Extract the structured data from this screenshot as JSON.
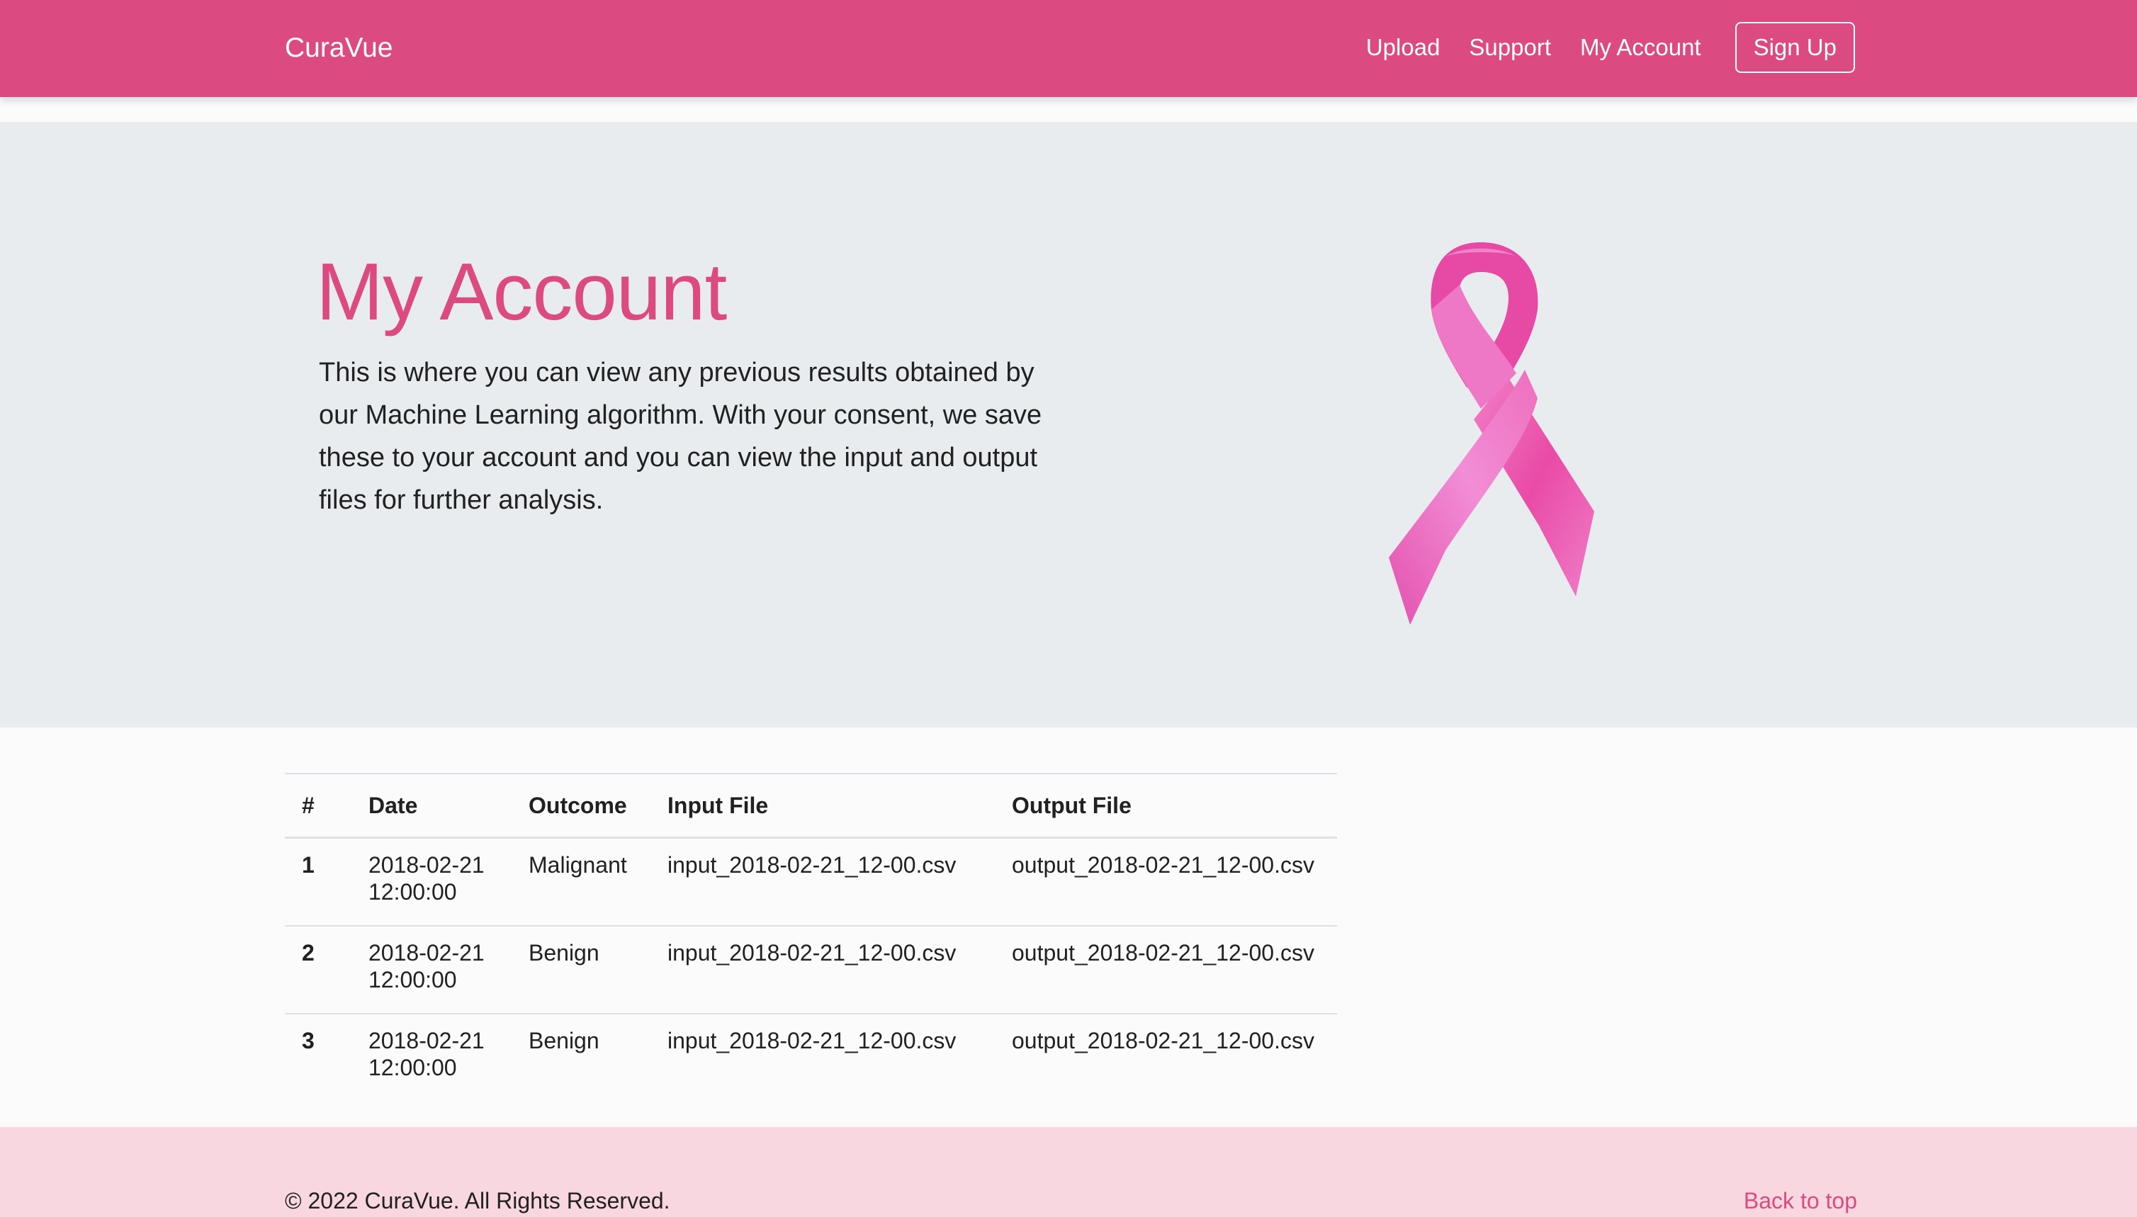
{
  "navbar": {
    "brand": "CuraVue",
    "links": [
      "Upload",
      "Support",
      "My Account"
    ],
    "signup_label": "Sign Up"
  },
  "hero": {
    "title": "My Account",
    "text": "This is where you can view any previous results obtained by our Machine Learning algorithm. With your consent, we save these to your account and you can view the input and output files for further analysis."
  },
  "table": {
    "headers": [
      "#",
      "Date",
      "Outcome",
      "Input File",
      "Output File"
    ],
    "rows": [
      {
        "num": "1",
        "date": "2018-02-21",
        "time": "12:00:00",
        "outcome": "Malignant",
        "input": "input_2018-02-21_12-00.csv",
        "output": "output_2018-02-21_12-00.csv"
      },
      {
        "num": "2",
        "date": "2018-02-21",
        "time": "12:00:00",
        "outcome": "Benign",
        "input": "input_2018-02-21_12-00.csv",
        "output": "output_2018-02-21_12-00.csv"
      },
      {
        "num": "3",
        "date": "2018-02-21",
        "time": "12:00:00",
        "outcome": "Benign",
        "input": "input_2018-02-21_12-00.csv",
        "output": "output_2018-02-21_12-00.csv"
      }
    ]
  },
  "footer": {
    "copyright": "© 2022 CuraVue. All Rights Reserved.",
    "back_to_top": "Back to top"
  },
  "colors": {
    "brand_pink": "#dc4a82",
    "hero_bg": "#e9ecef",
    "footer_bg": "#f8d7e0",
    "ribbon_pink": "#e94ba6"
  },
  "icons": {
    "ribbon": "awareness-ribbon-icon"
  }
}
